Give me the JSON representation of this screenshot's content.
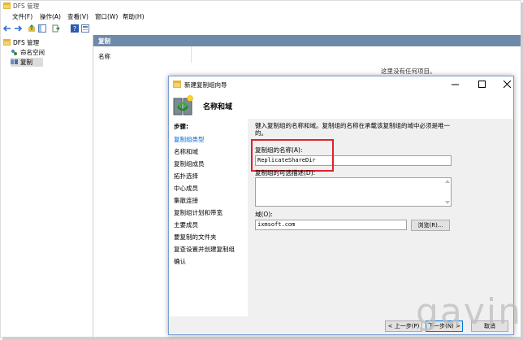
{
  "window": {
    "title": "DFS 管理"
  },
  "menu": [
    "文件(F)",
    "操作(A)",
    "查看(V)",
    "窗口(W)",
    "帮助(H)"
  ],
  "tree": {
    "root": "DFS 管理",
    "items": [
      "命名空间",
      "复制"
    ]
  },
  "panel": {
    "header": "复制",
    "column": "名称",
    "empty": "这里没有任何项目。"
  },
  "wizard": {
    "title": "新建复制组向导",
    "heading": "名称和域",
    "steps_label": "步骤:",
    "steps": [
      "复制组类型",
      "名称和域",
      "复制组成员",
      "拓扑选择",
      "中心成员",
      "集散连接",
      "复制组计划和带宽",
      "主要成员",
      "要复制的文件夹",
      "复查设置并创建复制组",
      "确认"
    ],
    "description": "键入复制组的名称和域。复制组的名称在承载该复制组的域中必须是唯一的。",
    "name_label": "复制组的名称(A):",
    "name_value": "ReplicateShareDir",
    "desc_label": "复制组的可选描述(D):",
    "domain_label": "域(O):",
    "domain_value": "ixmsoft.com",
    "browse": "浏览(R)...",
    "back": "< 上一步(P)",
    "next": "下一步(N) >",
    "cancel": "取消"
  },
  "watermark": "gavin",
  "colors": {
    "accent": "#0066cc",
    "panel_header": "#6f8aa8",
    "highlight_box": "#e0212a"
  }
}
